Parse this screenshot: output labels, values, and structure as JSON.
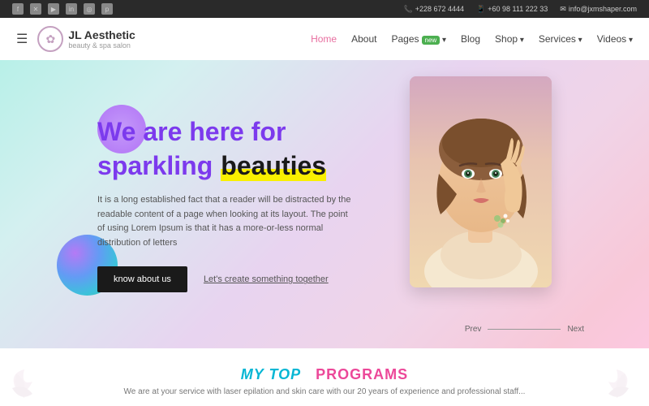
{
  "topbar": {
    "phone1": "+228 672 4444",
    "phone2": "+60 98 111 222 33",
    "email": "info@jxmshaper.com",
    "socials": [
      "f",
      "t",
      "yt",
      "in",
      "ig",
      "p"
    ]
  },
  "header": {
    "logo_name": "JL Aesthetic",
    "logo_tagline": "beauty & spa salon",
    "nav": [
      {
        "label": "Home",
        "active": true,
        "badge": null,
        "dropdown": false
      },
      {
        "label": "About",
        "active": false,
        "badge": null,
        "dropdown": false
      },
      {
        "label": "Pages",
        "active": false,
        "badge": "new",
        "dropdown": true
      },
      {
        "label": "Blog",
        "active": false,
        "badge": null,
        "dropdown": false
      },
      {
        "label": "Shop",
        "active": false,
        "badge": null,
        "dropdown": true
      },
      {
        "label": "Services",
        "active": false,
        "badge": null,
        "dropdown": true
      },
      {
        "label": "Videos",
        "active": false,
        "badge": null,
        "dropdown": true
      }
    ]
  },
  "hero": {
    "headline1": "We are here for",
    "headline2": "sparkling",
    "headline3": "beauties",
    "description": "It is a long established fact that a reader will be distracted by the readable content of a page when looking at its layout. The point of using Lorem Ipsum is that it has a more-or-less normal distribution of letters",
    "btn_know": "know about us",
    "btn_create": "Let's create something together",
    "prev": "Prev",
    "next": "Next"
  },
  "bottom": {
    "title_part1": "MY TOP",
    "title_part2": "PROGRAMS",
    "subtitle": "We are at your service with laser epilation and skin care with our 20 years of experience and professional staff..."
  }
}
